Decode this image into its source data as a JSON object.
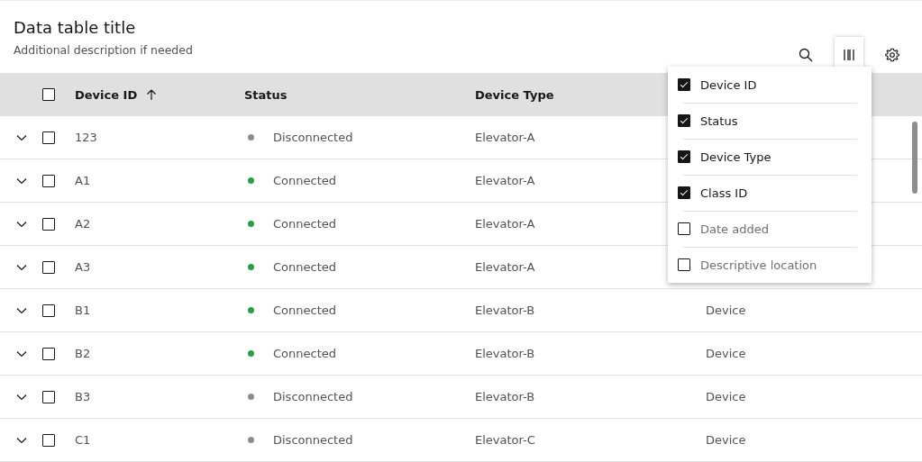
{
  "header": {
    "title": "Data table title",
    "description": "Additional description if needed"
  },
  "toolbar": [
    {
      "kind": "search",
      "active": false
    },
    {
      "kind": "columns",
      "active": true
    },
    {
      "kind": "settings",
      "active": false
    }
  ],
  "table": {
    "select_all": {
      "checked": false
    },
    "columns": [
      {
        "label": "Device ID",
        "sorted": true
      },
      {
        "label": "Status",
        "sorted": false
      },
      {
        "label": "Device Type",
        "sorted": false
      }
    ],
    "rows": [
      {
        "expanded": false,
        "selected": false,
        "device_id": "123",
        "status": "Disconnected",
        "color": "#8d8d8d",
        "device_type": "Elevator-A"
      },
      {
        "expanded": false,
        "selected": false,
        "device_id": "A1",
        "status": "Connected",
        "color": "#24a148",
        "device_type": "Elevator-A"
      },
      {
        "expanded": false,
        "selected": false,
        "device_id": "A2",
        "status": "Connected",
        "color": "#24a148",
        "device_type": "Elevator-A"
      },
      {
        "expanded": false,
        "selected": false,
        "device_id": "A3",
        "status": "Connected",
        "color": "#24a148",
        "device_type": "Elevator-A"
      },
      {
        "expanded": false,
        "selected": false,
        "device_id": "B1",
        "status": "Connected",
        "color": "#24a148",
        "device_type": "Elevator-B",
        "column_4": "Device"
      },
      {
        "expanded": false,
        "selected": false,
        "device_id": "B2",
        "status": "Connected",
        "color": "#24a148",
        "device_type": "Elevator-B",
        "column_4": "Device"
      },
      {
        "expanded": false,
        "selected": false,
        "device_id": "B3",
        "status": "Disconnected",
        "color": "#8d8d8d",
        "device_type": "Elevator-B",
        "column_4": "Device"
      },
      {
        "expanded": false,
        "selected": false,
        "device_id": "C1",
        "status": "Disconnected",
        "color": "#8d8d8d",
        "device_type": "Elevator-C",
        "column_4": "Device"
      }
    ]
  },
  "column_menu": {
    "items": [
      {
        "label": "Device ID",
        "checked": true
      },
      {
        "label": "Status",
        "checked": true
      },
      {
        "label": "Device Type",
        "checked": true
      },
      {
        "label": "Class ID",
        "checked": true
      },
      {
        "label": "Date added",
        "checked": false
      },
      {
        "label": "Descriptive location",
        "checked": false
      }
    ]
  }
}
